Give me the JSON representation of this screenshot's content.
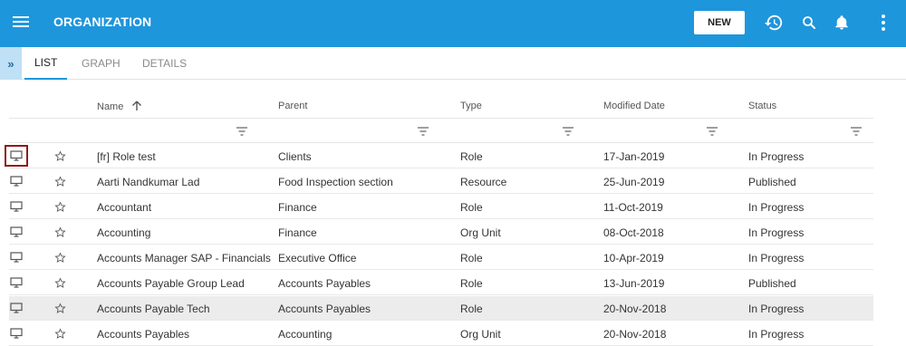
{
  "header": {
    "title": "ORGANIZATION",
    "new_label": "NEW",
    "bg_color": "#1e96dc"
  },
  "tabs": [
    {
      "label": "LIST",
      "active": true
    },
    {
      "label": "GRAPH",
      "active": false
    },
    {
      "label": "DETAILS",
      "active": false
    }
  ],
  "table": {
    "columns": [
      "Name",
      "Parent",
      "Type",
      "Modified Date",
      "Status"
    ],
    "sort": {
      "column": "Name",
      "direction": "ascending"
    },
    "rows": [
      {
        "name": "[fr] Role test",
        "parent": "Clients",
        "type": "Role",
        "modified": "17-Jan-2019",
        "status": "In Progress",
        "selected": true
      },
      {
        "name": "Aarti Nandkumar Lad",
        "parent": "Food Inspection section",
        "type": "Resource",
        "modified": "25-Jun-2019",
        "status": "Published"
      },
      {
        "name": "Accountant",
        "parent": "Finance",
        "type": "Role",
        "modified": "11-Oct-2019",
        "status": "In Progress"
      },
      {
        "name": "Accounting",
        "parent": "Finance",
        "type": "Org Unit",
        "modified": "08-Oct-2018",
        "status": "In Progress"
      },
      {
        "name": "Accounts Manager SAP - Financials",
        "parent": "Executive Office",
        "type": "Role",
        "modified": "10-Apr-2019",
        "status": "In Progress"
      },
      {
        "name": "Accounts Payable Group Lead",
        "parent": "Accounts Payables",
        "type": "Role",
        "modified": "13-Jun-2019",
        "status": "Published"
      },
      {
        "name": "Accounts Payable Tech",
        "parent": "Accounts Payables",
        "type": "Role",
        "modified": "20-Nov-2018",
        "status": "In Progress",
        "highlighted": true
      },
      {
        "name": "Accounts Payables",
        "parent": "Accounting",
        "type": "Org Unit",
        "modified": "20-Nov-2018",
        "status": "In Progress"
      }
    ]
  }
}
